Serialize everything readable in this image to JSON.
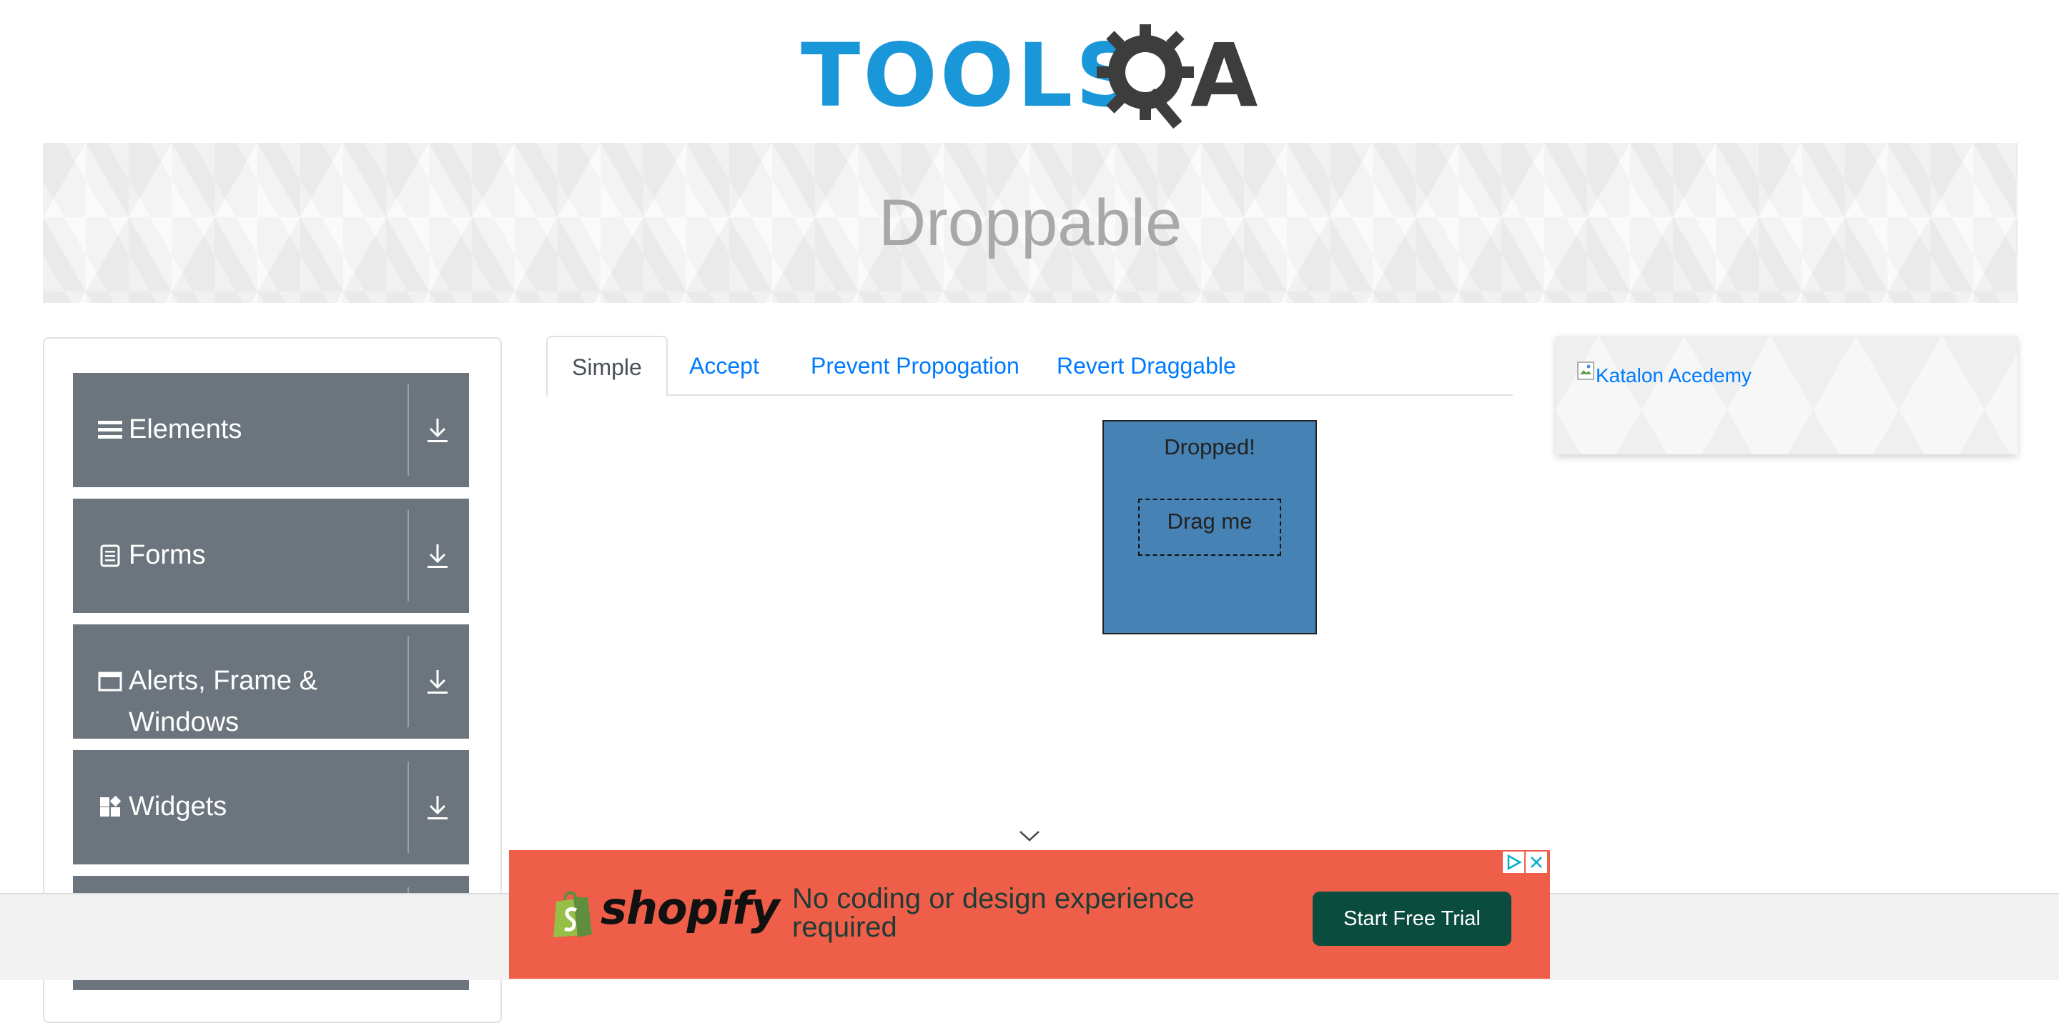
{
  "logo": {
    "text": "TOOLS",
    "suffix": "A",
    "gear_letter": "Q"
  },
  "banner": {
    "title": "Droppable"
  },
  "sidebar": {
    "groups": [
      {
        "label": "Elements",
        "icon": "hamburger-icon"
      },
      {
        "label": "Forms",
        "icon": "document-icon"
      },
      {
        "label": "Alerts, Frame & Windows",
        "icon": "window-icon"
      },
      {
        "label": "Widgets",
        "icon": "widgets-icon"
      }
    ],
    "toggle_icon": "download-arrow-icon"
  },
  "tabs": [
    {
      "label": "Simple",
      "active": true
    },
    {
      "label": "Accept",
      "active": false
    },
    {
      "label": "Prevent Propogation",
      "active": false
    },
    {
      "label": "Revert Draggable",
      "active": false
    }
  ],
  "drop_area": {
    "status_text": "Dropped!",
    "draggable_label": "Drag me",
    "color": "#4682b4"
  },
  "side_ad": {
    "alt_text": "Katalon Acedemy"
  },
  "bottom_ad": {
    "brand": "shopify",
    "message": "No coding or design experience required",
    "cta_label": "Start Free Trial",
    "background": "#ef5e48",
    "cta_color": "#0a4d3e"
  }
}
